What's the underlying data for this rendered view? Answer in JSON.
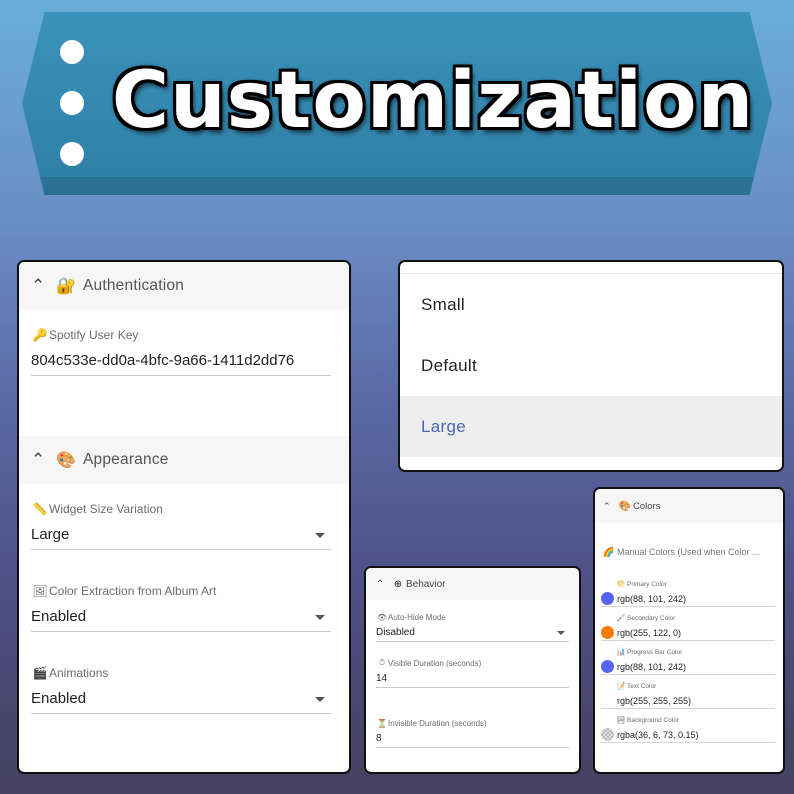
{
  "banner": {
    "title": "Customization"
  },
  "auth_panel": {
    "authentication": {
      "title": "Authentication",
      "chevron_icon": "chevron-up",
      "icon": "lock-key-icon",
      "icon_glyph": "🔐",
      "fields": [
        {
          "label": "Spotify User Key",
          "icon": "key-icon",
          "icon_glyph": "🔑",
          "value": "804c533e-dd0a-4bfc-9a66-1411d2dd76"
        }
      ]
    },
    "appearance": {
      "title": "Appearance",
      "chevron_icon": "chevron-up",
      "icon": "palette-icon",
      "icon_glyph": "🎨",
      "fields": [
        {
          "label": "Widget Size Variation",
          "icon": "ruler-icon",
          "icon_glyph": "📏",
          "value": "Large"
        },
        {
          "label": "Color Extraction from Album Art",
          "icon": "picture-icon",
          "icon_glyph": "🖼",
          "value": "Enabled"
        },
        {
          "label": "Animations",
          "icon": "clapper-icon",
          "icon_glyph": "🎬",
          "value": "Enabled"
        }
      ]
    }
  },
  "size_dropdown": {
    "options": [
      "Small",
      "Default",
      "Large"
    ],
    "selected": "Large",
    "selected_color": "#4e63b9"
  },
  "behavior_panel": {
    "title": "Behavior",
    "icon": "plus-circle-icon",
    "icon_glyph": "⊕",
    "fields": [
      {
        "label": "Auto-Hide Mode",
        "icon": "eye-icon",
        "icon_glyph": "👁",
        "value": "Disabled"
      },
      {
        "label": "Visible Duration (seconds)",
        "icon": "stopwatch-icon",
        "icon_glyph": "⏱",
        "value": "14"
      },
      {
        "label": "Invisible Duration (seconds)",
        "icon": "hourglass-icon",
        "icon_glyph": "⏳",
        "value": "8"
      }
    ]
  },
  "colors_panel": {
    "title": "Colors",
    "icon": "palette-icon",
    "icon_glyph": "🎨",
    "manual_label": "Manual Colors (Used when Color ...",
    "manual_icon": "rainbow-icon",
    "manual_icon_glyph": "🌈",
    "items": [
      {
        "label": "Primary Color",
        "icon": "sun-icon",
        "icon_glyph": "🌕",
        "value": "rgb(88, 101, 242)",
        "swatch": "#5865f2"
      },
      {
        "label": "Secondary Color",
        "icon": "brush-icon",
        "icon_glyph": "🖌",
        "value": "rgb(255, 122, 0)",
        "swatch": "#ff7a00"
      },
      {
        "label": "Progress Bar Color",
        "icon": "bar-chart-icon",
        "icon_glyph": "📊",
        "value": "rgb(88, 101, 242)",
        "swatch": "#5865f2"
      },
      {
        "label": "Text Color",
        "icon": "memo-icon",
        "icon_glyph": "📝",
        "value": "rgb(255, 255, 255)",
        "swatch": "#ffffff"
      },
      {
        "label": "Background Color",
        "icon": "landscape-icon",
        "icon_glyph": "🏞",
        "value": "rgba(36, 6, 73, 0.15)",
        "swatch": "transparent"
      }
    ]
  },
  "colors": {
    "banner": "#3a92bb",
    "accent": "#4e63b9"
  }
}
